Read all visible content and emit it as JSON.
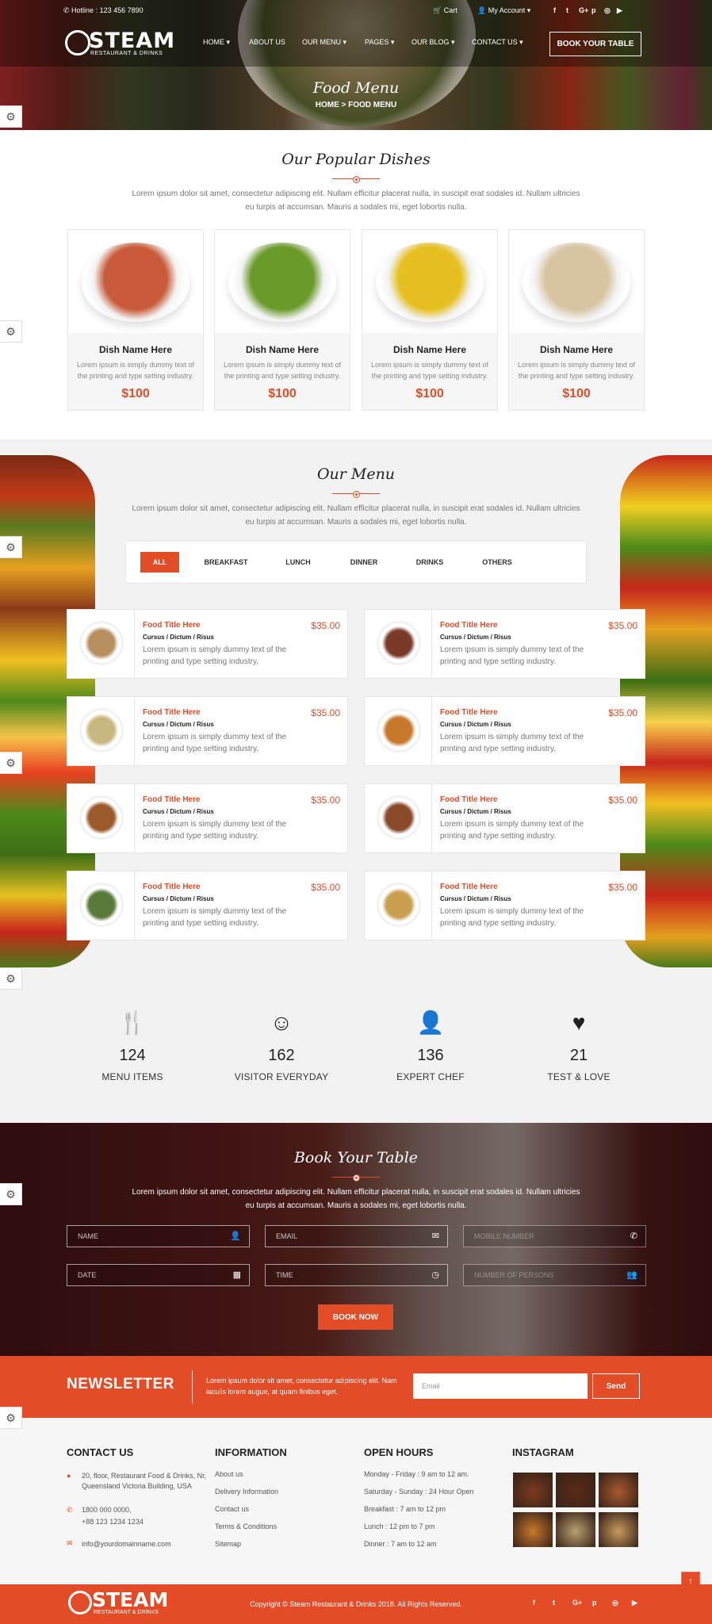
{
  "topbar": {
    "hotline": "Hotline : 123 456 7890",
    "cart": "Cart",
    "account": "My Account",
    "social_icons": [
      "facebook-icon",
      "twitter-icon",
      "google-plus-icon",
      "pinterest-icon",
      "instagram-icon",
      "youtube-icon"
    ],
    "social_glyphs": [
      "f",
      "t",
      "G+",
      "p",
      "◎",
      "▶"
    ]
  },
  "header": {
    "logo_word": "STEAM",
    "logo_sub": "RESTAURANT & DRINKS",
    "nav": [
      "HOME ▾",
      "ABOUT US",
      "OUR MENU ▾",
      "PAGES ▾",
      "OUR BLOG ▾",
      "CONTACT US ▾"
    ],
    "book_button": "BOOK YOUR TABLE"
  },
  "hero": {
    "title": "Food Menu",
    "breadcrumb": "HOME  >  FOOD MENU"
  },
  "popular": {
    "title": "Our Popular Dishes",
    "intro": "Lorem ipsum dolor sit amet, consectetur adipiscing elit. Nullam efficitur placerat nulla, in suscipit erat sodales id. Nullam ultricies eu turpis at accumsan. Mauris a sodales mi, eget lobortis nulla.",
    "dishes": [
      {
        "name": "Dish Name Here",
        "desc": "Lorem ipsum is simply dummy text of the printing and type setting industry.",
        "price": "$100",
        "color": "#c95a3a"
      },
      {
        "name": "Dish Name Here",
        "desc": "Lorem ipsum is simply dummy text of the printing and type setting industry.",
        "price": "$100",
        "color": "#6a9a2a"
      },
      {
        "name": "Dish Name Here",
        "desc": "Lorem ipsum is simply dummy text of the printing and type setting industry.",
        "price": "$100",
        "color": "#e6c020"
      },
      {
        "name": "Dish Name Here",
        "desc": "Lorem ipsum is simply dummy text of the printing and type setting industry.",
        "price": "$100",
        "color": "#d8c4a0"
      }
    ]
  },
  "menu": {
    "title": "Our Menu",
    "intro": "Lorem ipsum dolor sit amet, consectetur adipiscing elit. Nullam efficitur placerat nulla, in suscipit erat sodales id. Nullam ultricies eu turpis at accumsan. Mauris a sodales mi, eget lobortis nulla.",
    "tabs": [
      "ALL",
      "BREAKFAST",
      "LUNCH",
      "DINNER",
      "DRINKS",
      "OTHERS"
    ],
    "active_tab": "ALL",
    "items": [
      {
        "title": "Food Title Here",
        "sub": "Cursus / Dictum / Risus",
        "desc": "Lorem ipsum is simply dummy text of the printing and type setting industry.",
        "price": "$35.00",
        "color": "#b89060"
      },
      {
        "title": "Food Title Here",
        "sub": "Cursus / Dictum / Risus",
        "desc": "Lorem ipsum is simply dummy text of the printing and type setting industry.",
        "price": "$35.00",
        "color": "#7a3a2a"
      },
      {
        "title": "Food Title Here",
        "sub": "Cursus / Dictum / Risus",
        "desc": "Lorem ipsum is simply dummy text of the printing and type setting industry.",
        "price": "$35.00",
        "color": "#c8b880"
      },
      {
        "title": "Food Title Here",
        "sub": "Cursus / Dictum / Risus",
        "desc": "Lorem ipsum is simply dummy text of the printing and type setting industry.",
        "price": "$35.00",
        "color": "#c8782a"
      },
      {
        "title": "Food Title Here",
        "sub": "Cursus / Dictum / Risus",
        "desc": "Lorem ipsum is simply dummy text of the printing and type setting industry.",
        "price": "$35.00",
        "color": "#9a5a2a"
      },
      {
        "title": "Food Title Here",
        "sub": "Cursus / Dictum / Risus",
        "desc": "Lorem ipsum is simply dummy text of the printing and type setting industry.",
        "price": "$35.00",
        "color": "#8a4a2a"
      },
      {
        "title": "Food Title Here",
        "sub": "Cursus / Dictum / Risus",
        "desc": "Lorem ipsum is simply dummy text of the printing and type setting industry.",
        "price": "$35.00",
        "color": "#5a7a3a"
      },
      {
        "title": "Food Title Here",
        "sub": "Cursus / Dictum / Risus",
        "desc": "Lorem ipsum is simply dummy text of the printing and type setting industry.",
        "price": "$35.00",
        "color": "#c8a050"
      }
    ]
  },
  "counters": [
    {
      "icon": "cutlery-icon",
      "glyph": "🍴",
      "number": "124",
      "label": "MENU ITEMS"
    },
    {
      "icon": "smiley-icon",
      "glyph": "☺",
      "number": "162",
      "label": "VISITOR EVERYDAY"
    },
    {
      "icon": "chef-icon",
      "glyph": "👤",
      "number": "136",
      "label": "EXPERT CHEF"
    },
    {
      "icon": "heart-icon",
      "glyph": "♥",
      "number": "21",
      "label": "TEST & LOVE"
    }
  ],
  "booking": {
    "title": "Book Your Table",
    "intro": "Lorem ipsum dolor sit amet, consectetur adipiscing elit. Nullam efficitur placerat nulla, in suscipit erat sodales id. Nullam ultricies eu turpis at accumsan. Mauris a sodales mi, eget lobortis nulla.",
    "fields": [
      {
        "placeholder": "NAME",
        "icon": "user-icon",
        "glyph": "👤"
      },
      {
        "placeholder": "EMAIL",
        "icon": "envelope-icon",
        "glyph": "✉"
      },
      {
        "placeholder": "MOBILE NUMBER",
        "icon": "phone-icon",
        "glyph": "✆"
      },
      {
        "placeholder": "DATE",
        "icon": "calendar-icon",
        "glyph": "▦"
      },
      {
        "placeholder": "TIME",
        "icon": "clock-icon",
        "glyph": "◷"
      },
      {
        "placeholder": "NUMBER OF PERSONS",
        "icon": "users-icon",
        "glyph": "👥"
      }
    ],
    "button": "BOOK NOW"
  },
  "newsletter": {
    "title": "NEWSLETTER",
    "text": "Lorem ipsum dolor sit amet, consectetur adipiscing elit. Nam iaculis lorem augue, at quam finibus eget.",
    "placeholder": "Email",
    "button": "Send"
  },
  "footer": {
    "contact": {
      "title": "CONTACT US",
      "address": "20, floor, Restaurant Food & Drinks, Nr, Queensland Victoria Building, USA",
      "phone1": "1800 000 0000,",
      "phone2": "+88 123 1234 1234",
      "email": "info@yourdomainname.com"
    },
    "information": {
      "title": "INFORMATION",
      "links": [
        "About us",
        "Delivery Information",
        "Contact us",
        "Terms & Conditions",
        "Sitemap"
      ]
    },
    "hours": {
      "title": "OPEN HOURS",
      "lines": [
        "Monday - Friday : 9 am to 12 am.",
        "Saturday - Sunday : 24 Hour Open",
        "Breakfast : 7 am to 12 pm",
        "Lunch : 12 pm to 7 pm",
        "Dinner : 7 am to 12 am"
      ]
    },
    "instagram": {
      "title": "INSTAGRAM",
      "colors": [
        "#7a3a20",
        "#5a2a18",
        "#a85a30",
        "#c8782a",
        "#b8a070",
        "#c89a60"
      ]
    }
  },
  "bottom": {
    "copyright": "Copyright © Steam Restaurant & Drinks 2018. All Rights Reserved.",
    "social_glyphs": [
      "f",
      "t",
      "G+",
      "p",
      "◎",
      "▶"
    ]
  },
  "accent_color": "#e44c27"
}
